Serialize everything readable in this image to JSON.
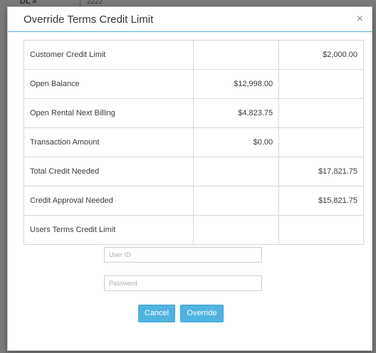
{
  "background": {
    "label": "DL #",
    "value": "2222"
  },
  "dialog": {
    "title": "Override Terms Credit Limit",
    "close_glyph": "×"
  },
  "rows": [
    {
      "label": "Customer Credit Limit",
      "open": "",
      "limit": "$2,000.00"
    },
    {
      "label": "Open Balance",
      "open": "$12,998.00",
      "limit": ""
    },
    {
      "label": "Open Rental Next Billing",
      "open": "$4,823.75",
      "limit": ""
    },
    {
      "label": "Transaction Amount",
      "open": "$0.00",
      "limit": ""
    },
    {
      "label": "Total Credit Needed",
      "open": "",
      "limit": "$17,821.75"
    },
    {
      "label": "Credit Approval Needed",
      "open": "",
      "limit": "$15,821.75"
    },
    {
      "label": "Users Terms Credit Limit",
      "open": "",
      "limit": ""
    }
  ],
  "form": {
    "user_id": {
      "value": "",
      "placeholder": "User ID"
    },
    "password": {
      "value": "",
      "placeholder": "Password"
    }
  },
  "buttons": {
    "cancel": "Cancel",
    "override": "Override"
  },
  "colors": {
    "accent": "#4fb3e0",
    "header_rule": "#4fb3d6",
    "overlay": "#7a7a7a"
  }
}
